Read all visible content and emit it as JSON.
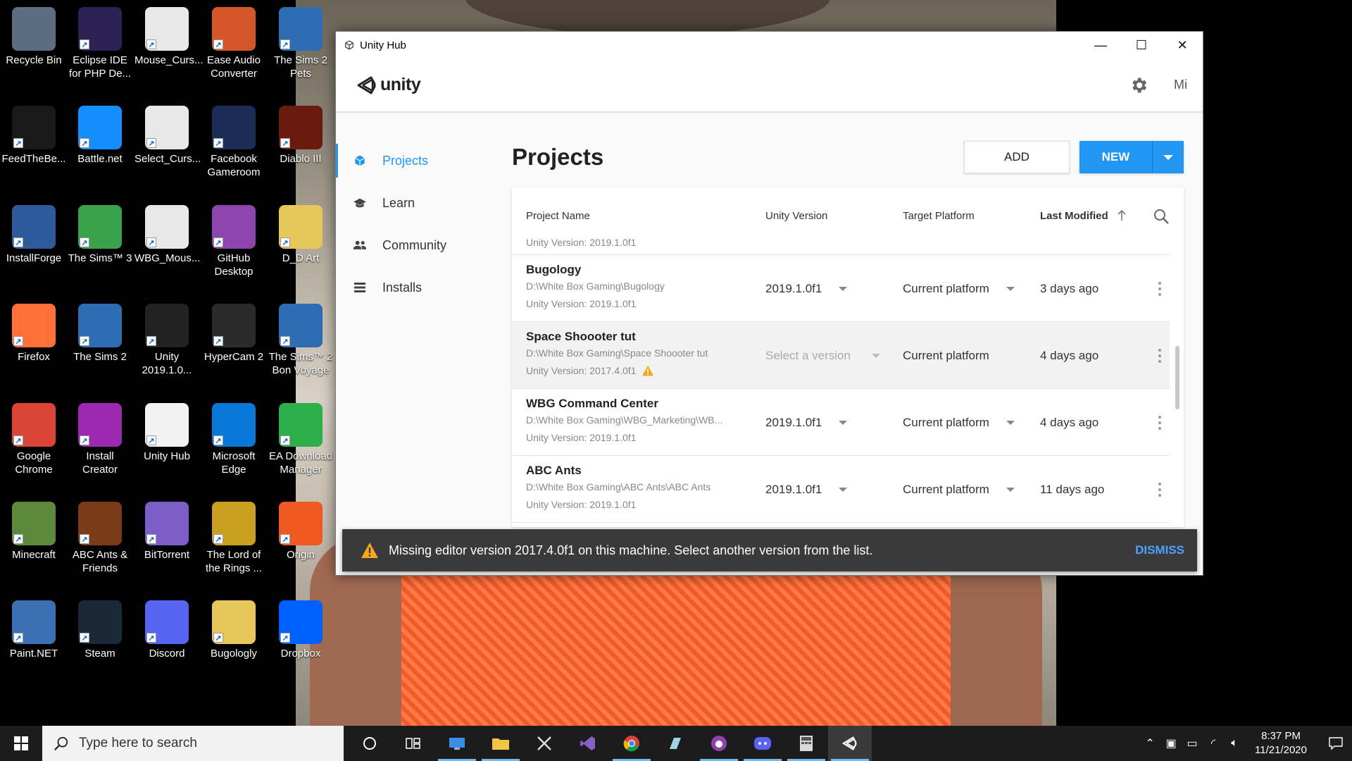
{
  "desktop": {
    "icons": [
      {
        "label": "Recycle Bin",
        "icon": "recycle-bin-icon",
        "color": "#5b6d80"
      },
      {
        "label": "Eclipse IDE for PHP De...",
        "icon": "eclipse-icon",
        "color": "#2c2255"
      },
      {
        "label": "Mouse_Curs...",
        "icon": "csharp-file-icon",
        "color": "#e8e8e8"
      },
      {
        "label": "Ease Audio Converter",
        "icon": "audio-converter-icon",
        "color": "#d4572a"
      },
      {
        "label": "The Sims 2 Pets",
        "icon": "sims-icon",
        "color": "#2e6db4"
      },
      {
        "label": "FeedTheBe...",
        "icon": "ftb-icon",
        "color": "#1a1a1a"
      },
      {
        "label": "Battle.net",
        "icon": "battlenet-icon",
        "color": "#148eff"
      },
      {
        "label": "Select_Curs...",
        "icon": "csharp-file-icon",
        "color": "#e8e8e8"
      },
      {
        "label": "Facebook Gameroom",
        "icon": "gameroom-icon",
        "color": "#1d2b57"
      },
      {
        "label": "Diablo III",
        "icon": "diablo-icon",
        "color": "#6b1a0e"
      },
      {
        "label": "InstallForge",
        "icon": "installforge-icon",
        "color": "#2f5b9c"
      },
      {
        "label": "The Sims™ 3",
        "icon": "sims-icon",
        "color": "#37a24a"
      },
      {
        "label": "WBG_Mous...",
        "icon": "csharp-file-icon",
        "color": "#e8e8e8"
      },
      {
        "label": "GitHub Desktop",
        "icon": "github-icon",
        "color": "#8e44ad"
      },
      {
        "label": "D_D Art",
        "icon": "folder-icon",
        "color": "#e8c75a"
      },
      {
        "label": "Firefox",
        "icon": "firefox-icon",
        "color": "#ff7139"
      },
      {
        "label": "The Sims 2",
        "icon": "sims-icon",
        "color": "#2e6db4"
      },
      {
        "label": "Unity 2019.1.0...",
        "icon": "unity-icon",
        "color": "#222222"
      },
      {
        "label": "HyperCam 2",
        "icon": "hypercam-icon",
        "color": "#2b2b2b"
      },
      {
        "label": "The Sims™ 2 Bon Voyage",
        "icon": "sims-icon",
        "color": "#2e6db4"
      },
      {
        "label": "Google Chrome",
        "icon": "chrome-icon",
        "color": "#db4437"
      },
      {
        "label": "Install Creator",
        "icon": "install-creator-icon",
        "color": "#9c27b0"
      },
      {
        "label": "Unity Hub",
        "icon": "unity-hub-icon",
        "color": "#f2f2f2"
      },
      {
        "label": "Microsoft Edge",
        "icon": "edge-icon",
        "color": "#0a78d7"
      },
      {
        "label": "EA Download Manager",
        "icon": "ea-icon",
        "color": "#2db04b"
      },
      {
        "label": "Minecraft",
        "icon": "minecraft-icon",
        "color": "#5d8a3a"
      },
      {
        "label": "ABC Ants & Friends",
        "icon": "ant-icon",
        "color": "#7a3b1a"
      },
      {
        "label": "BitTorrent",
        "icon": "bittorrent-icon",
        "color": "#7b5fc7"
      },
      {
        "label": "The Lord of the Rings ...",
        "icon": "ring-icon",
        "color": "#c9a020"
      },
      {
        "label": "Origin",
        "icon": "origin-icon",
        "color": "#f05a22"
      },
      {
        "label": "Paint.NET",
        "icon": "paintnet-icon",
        "color": "#3d6fb5"
      },
      {
        "label": "Steam",
        "icon": "steam-icon",
        "color": "#1b2838"
      },
      {
        "label": "Discord",
        "icon": "discord-icon",
        "color": "#5865f2"
      },
      {
        "label": "Bugologly",
        "icon": "folder-icon",
        "color": "#e8c75a"
      },
      {
        "label": "Dropbox",
        "icon": "dropbox-icon",
        "color": "#0061ff"
      }
    ]
  },
  "window": {
    "title": "Unity Hub",
    "minimize": "—",
    "maximize": "☐",
    "close": "✕"
  },
  "header": {
    "logo_text": "unity",
    "account": "Mi"
  },
  "sidebar": {
    "items": [
      {
        "label": "Projects",
        "icon": "projects-cube-icon",
        "active": true
      },
      {
        "label": "Learn",
        "icon": "learn-cap-icon",
        "active": false
      },
      {
        "label": "Community",
        "icon": "community-people-icon",
        "active": false
      },
      {
        "label": "Installs",
        "icon": "installs-list-icon",
        "active": false
      }
    ]
  },
  "main": {
    "title": "Projects",
    "add_label": "ADD",
    "new_label": "NEW"
  },
  "table": {
    "columns": {
      "name": "Project Name",
      "version": "Unity Version",
      "platform": "Target Platform",
      "modified": "Last Modified"
    },
    "partial_row_text": "Unity Version: 2019.1.0f1",
    "rows": [
      {
        "name": "Bugology",
        "path": "D:\\White Box Gaming\\Bugology",
        "unity_version_label": "Unity Version: 2019.1.0f1",
        "version": "2019.1.0f1",
        "platform": "Current platform",
        "modified": "3 days ago",
        "warning": false,
        "highlight": false,
        "version_muted": false
      },
      {
        "name": "Space Shoooter tut",
        "path": "D:\\White Box Gaming\\Space Shoooter tut",
        "unity_version_label": "Unity Version: 2017.4.0f1",
        "version": "Select a version",
        "platform": "Current platform",
        "modified": "4 days ago",
        "warning": true,
        "highlight": true,
        "version_muted": true
      },
      {
        "name": "WBG Command Center",
        "path": "D:\\White Box Gaming\\WBG_Marketing\\WB...",
        "unity_version_label": "Unity Version: 2019.1.0f1",
        "version": "2019.1.0f1",
        "platform": "Current platform",
        "modified": "4 days ago",
        "warning": false,
        "highlight": false,
        "version_muted": false
      },
      {
        "name": "ABC Ants",
        "path": "D:\\White Box Gaming\\ABC Ants\\ABC Ants",
        "unity_version_label": "Unity Version: 2019.1.0f1",
        "version": "2019.1.0f1",
        "platform": "Current platform",
        "modified": "11 days ago",
        "warning": false,
        "highlight": false,
        "version_muted": false
      }
    ]
  },
  "toast": {
    "message": "Missing editor version 2017.4.0f1 on this machine. Select another version from the list.",
    "dismiss": "DISMISS"
  },
  "taskbar": {
    "search_placeholder": "Type here to search",
    "apps": [
      "cortana-icon",
      "task-view-icon",
      "desktop-app-icon",
      "file-explorer-icon",
      "snipping-icon",
      "visual-studio-icon",
      "chrome-icon",
      "notes-icon",
      "github-icon",
      "discord-icon",
      "calculator-icon",
      "unity-hub-icon"
    ],
    "time": "8:37 PM",
    "date": "11/21/2020"
  },
  "colors": {
    "accent": "#2196f3",
    "toast_bg": "#3a3a3a",
    "warning": "#f5a623"
  }
}
